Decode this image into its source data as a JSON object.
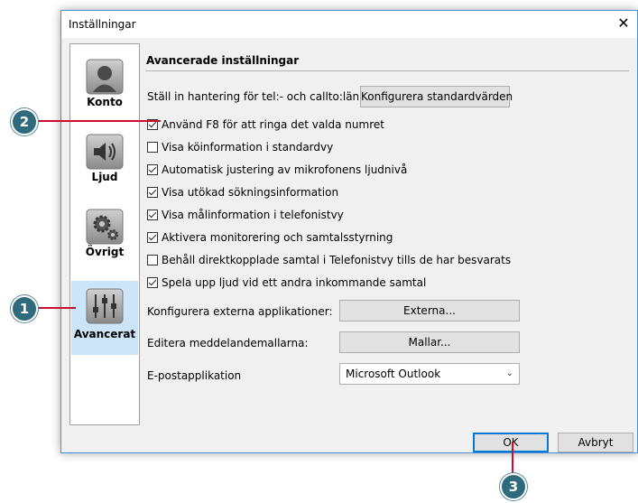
{
  "window": {
    "title": "Inställningar",
    "close_symbol": "✕"
  },
  "sidebar": {
    "items": [
      {
        "label": "Konto",
        "icon": "user-icon",
        "selected": false
      },
      {
        "label": "Ljud",
        "icon": "speaker-icon",
        "selected": false
      },
      {
        "label": "Övrigt",
        "icon": "gears-icon",
        "selected": false
      },
      {
        "label": "Avancerat",
        "icon": "sliders-icon",
        "selected": true
      }
    ]
  },
  "main": {
    "heading": "Avancerade inställningar",
    "tel_row": {
      "label": "Ställ in hantering för tel:- och callto:länkar",
      "button": "Konfigurera standardvärden"
    },
    "checkboxes": [
      {
        "label": "Använd F8 för att ringa det valda numret",
        "checked": true
      },
      {
        "label": "Visa köinformation i standardvy",
        "checked": false
      },
      {
        "label": "Automatisk justering av mikrofonens ljudnivå",
        "checked": true
      },
      {
        "label": "Visa utökad sökningsinformation",
        "checked": true
      },
      {
        "label": "Visa målinformation i telefonistvy",
        "checked": true
      },
      {
        "label": "Aktivera monitorering och samtalsstyrning",
        "checked": true
      },
      {
        "label": "Behåll direktkopplade samtal i Telefonistvy tills de har besvarats",
        "checked": false
      },
      {
        "label": "Spela upp ljud vid ett andra inkommande samtal",
        "checked": true
      }
    ],
    "ext_apps": {
      "label": "Konfigurera externa applikationer:",
      "button": "Externa..."
    },
    "templates": {
      "label": "Editera meddelandemallarna:",
      "button": "Mallar..."
    },
    "email": {
      "label": "E-postapplikation",
      "selected": "Microsoft Outlook"
    }
  },
  "footer": {
    "ok": "OK",
    "cancel": "Avbryt"
  },
  "callouts": [
    "1",
    "2",
    "3"
  ],
  "colors": {
    "callout": "#2f6b7c",
    "line": "#c8102e",
    "selected": "#cce4f7",
    "accent": "#0078d7"
  }
}
